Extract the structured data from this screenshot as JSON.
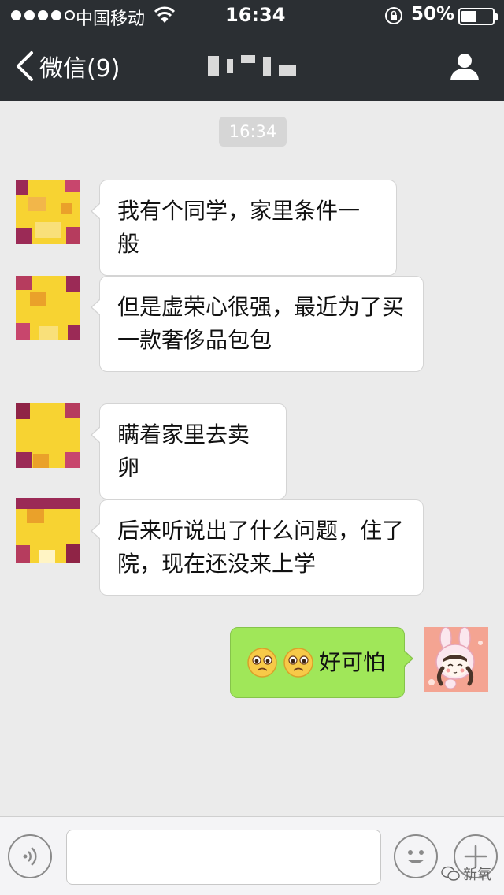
{
  "status_bar": {
    "carrier": "中国移动",
    "time": "16:34",
    "battery_percent": "50%",
    "battery_level": 0.5,
    "signal_bars": 4
  },
  "nav": {
    "back_label": "微信(9)"
  },
  "chat": {
    "timestamp": "16:34",
    "messages": [
      {
        "side": "left",
        "lines": [
          "我有个同学，家里条件一般"
        ]
      },
      {
        "side": "left",
        "lines": [
          "但是虚荣心很强，最近为了买",
          "一款奢侈品包包"
        ]
      },
      {
        "side": "left",
        "lines": [
          "瞒着家里去卖卵"
        ]
      },
      {
        "side": "left",
        "lines": [
          "后来听说出了什么问题，住了",
          "院，现在还没来上学"
        ]
      },
      {
        "side": "right",
        "emoji_count": 2,
        "text": "好可怕"
      }
    ]
  },
  "input": {
    "placeholder": ""
  },
  "watermark": {
    "text": "新氧"
  },
  "colors": {
    "nav_bg": "#2b2f33",
    "chat_bg": "#ebebeb",
    "bubble_in": "#ffffff",
    "bubble_out": "#a0e759"
  }
}
